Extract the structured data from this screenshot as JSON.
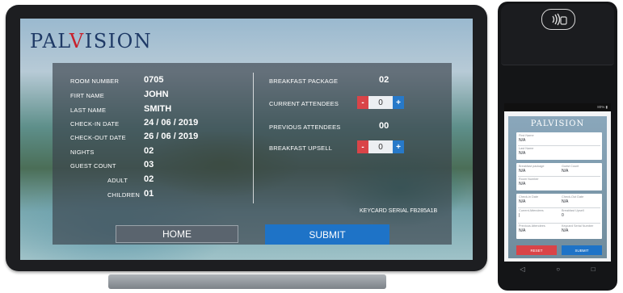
{
  "brand": {
    "name_start": "PAL",
    "name_accent": "V",
    "name_end": "ISION"
  },
  "guest": {
    "room_number": {
      "label": "ROOM NUMBER",
      "value": "0705"
    },
    "first_name": {
      "label": "FIRT NAME",
      "value": "JOHN"
    },
    "last_name": {
      "label": "LAST NAME",
      "value": "SMITH"
    },
    "check_in": {
      "label": "CHECK-IN DATE",
      "value": "24 / 06 / 2019"
    },
    "check_out": {
      "label": "CHECK-OUT DATE",
      "value": "26 / 06 / 2019"
    },
    "nights": {
      "label": "NIGHTS",
      "value": "02"
    },
    "guest_count": {
      "label": "GUEST COUNT",
      "value": "03"
    },
    "adult": {
      "label": "ADULT",
      "value": "02"
    },
    "children": {
      "label": "CHILDREN",
      "value": "01"
    }
  },
  "breakfast": {
    "package": {
      "label": "BREAKFAST PACKAGE",
      "value": "02"
    },
    "current_attendees": {
      "label": "CURRENT ATTENDEES",
      "value": "0",
      "minus": "-",
      "plus": "+"
    },
    "previous_attendees": {
      "label": "PREVIOUS ATTENDEES",
      "value": "00"
    },
    "upsell": {
      "label": "BREAKFAST UPSELL",
      "value": "0",
      "minus": "-",
      "plus": "+"
    }
  },
  "keycard": "KEYCARD SERIAL FB285A1B",
  "buttons": {
    "home": "HOME",
    "submit": "SUBMIT"
  },
  "terminal": {
    "status": "80% ▮",
    "logo": "PALVISION",
    "fields": {
      "first_name": {
        "label": "First Name",
        "value": "N/A"
      },
      "last_name": {
        "label": "Last Name",
        "value": "N/A"
      },
      "breakfast_package": {
        "label": "Breakfast package",
        "value": "N/A"
      },
      "guest_count": {
        "label": "Guest Count",
        "value": "N/A"
      },
      "room_number": {
        "label": "Room Number",
        "value": "N/A"
      },
      "check_in": {
        "label": "Check-in Date",
        "value": "N/A"
      },
      "check_out": {
        "label": "Check-Out Date",
        "value": "N/A"
      },
      "current_attendees": {
        "label": "Current Attendees",
        "value": "|"
      },
      "breakfast_upsell": {
        "label": "Breakfast Upsell",
        "value": "0"
      },
      "previous_attendees": {
        "label": "Previous Attendees",
        "value": "N/A"
      },
      "keycard_serial": {
        "label": "Keycard Serial Number",
        "value": "N/A"
      }
    },
    "reset": "RESET",
    "submit": "SUBMIT",
    "nav": {
      "back": "◁",
      "home": "○",
      "recents": "□"
    }
  },
  "colors": {
    "accent_blue": "#1e73c7",
    "accent_red": "#d94448",
    "logo_blue": "#1f3a66"
  }
}
